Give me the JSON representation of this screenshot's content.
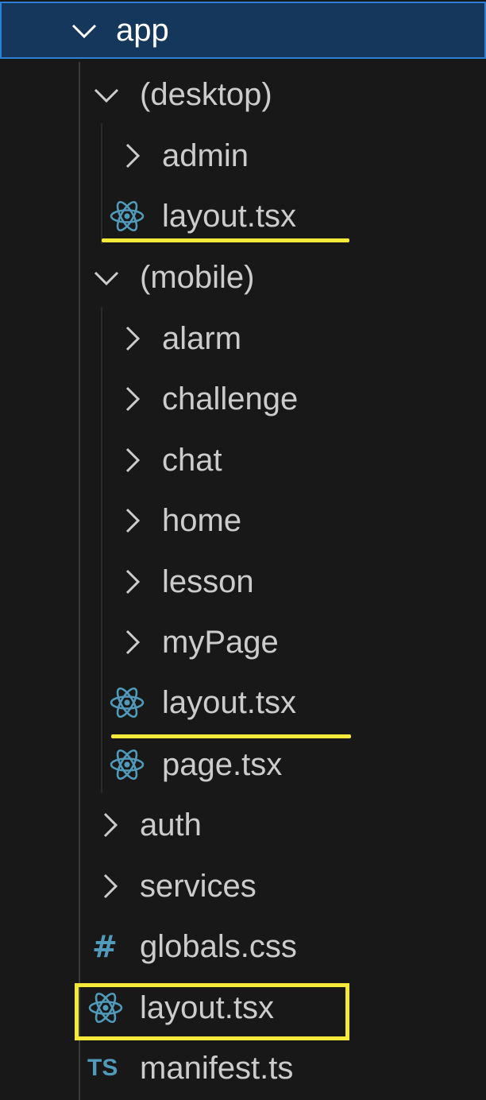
{
  "explorer": {
    "items": [
      {
        "kind": "folder",
        "label": "app",
        "expanded": true,
        "selected": true,
        "depth": 0
      },
      {
        "kind": "folder",
        "label": "(desktop)",
        "expanded": true,
        "depth": 1
      },
      {
        "kind": "folder",
        "label": "admin",
        "expanded": false,
        "depth": 2
      },
      {
        "kind": "file",
        "label": "layout.tsx",
        "icon": "react-icon",
        "depth": 2,
        "highlight": "underline"
      },
      {
        "kind": "folder",
        "label": "(mobile)",
        "expanded": true,
        "depth": 1
      },
      {
        "kind": "folder",
        "label": "alarm",
        "expanded": false,
        "depth": 2
      },
      {
        "kind": "folder",
        "label": "challenge",
        "expanded": false,
        "depth": 2
      },
      {
        "kind": "folder",
        "label": "chat",
        "expanded": false,
        "depth": 2
      },
      {
        "kind": "folder",
        "label": "home",
        "expanded": false,
        "depth": 2
      },
      {
        "kind": "folder",
        "label": "lesson",
        "expanded": false,
        "depth": 2
      },
      {
        "kind": "folder",
        "label": "myPage",
        "expanded": false,
        "depth": 2
      },
      {
        "kind": "file",
        "label": "layout.tsx",
        "icon": "react-icon",
        "depth": 2,
        "highlight": "underline"
      },
      {
        "kind": "file",
        "label": "page.tsx",
        "icon": "react-icon",
        "depth": 2
      },
      {
        "kind": "folder",
        "label": "auth",
        "expanded": false,
        "depth": 1
      },
      {
        "kind": "folder",
        "label": "services",
        "expanded": false,
        "depth": 1
      },
      {
        "kind": "file",
        "label": "globals.css",
        "icon": "css-hash-icon",
        "depth": 1
      },
      {
        "kind": "file",
        "label": "layout.tsx",
        "icon": "react-icon",
        "depth": 1,
        "highlight": "box"
      },
      {
        "kind": "file",
        "label": "manifest.ts",
        "icon": "typescript-icon",
        "icon_text": "TS",
        "depth": 1
      }
    ]
  },
  "colors": {
    "background": "#181818",
    "selected_background": "#15375c",
    "selected_border": "#2d7fd6",
    "text": "#cccccc",
    "icon_blue": "#519aba",
    "highlight_yellow": "#f4e93a"
  }
}
